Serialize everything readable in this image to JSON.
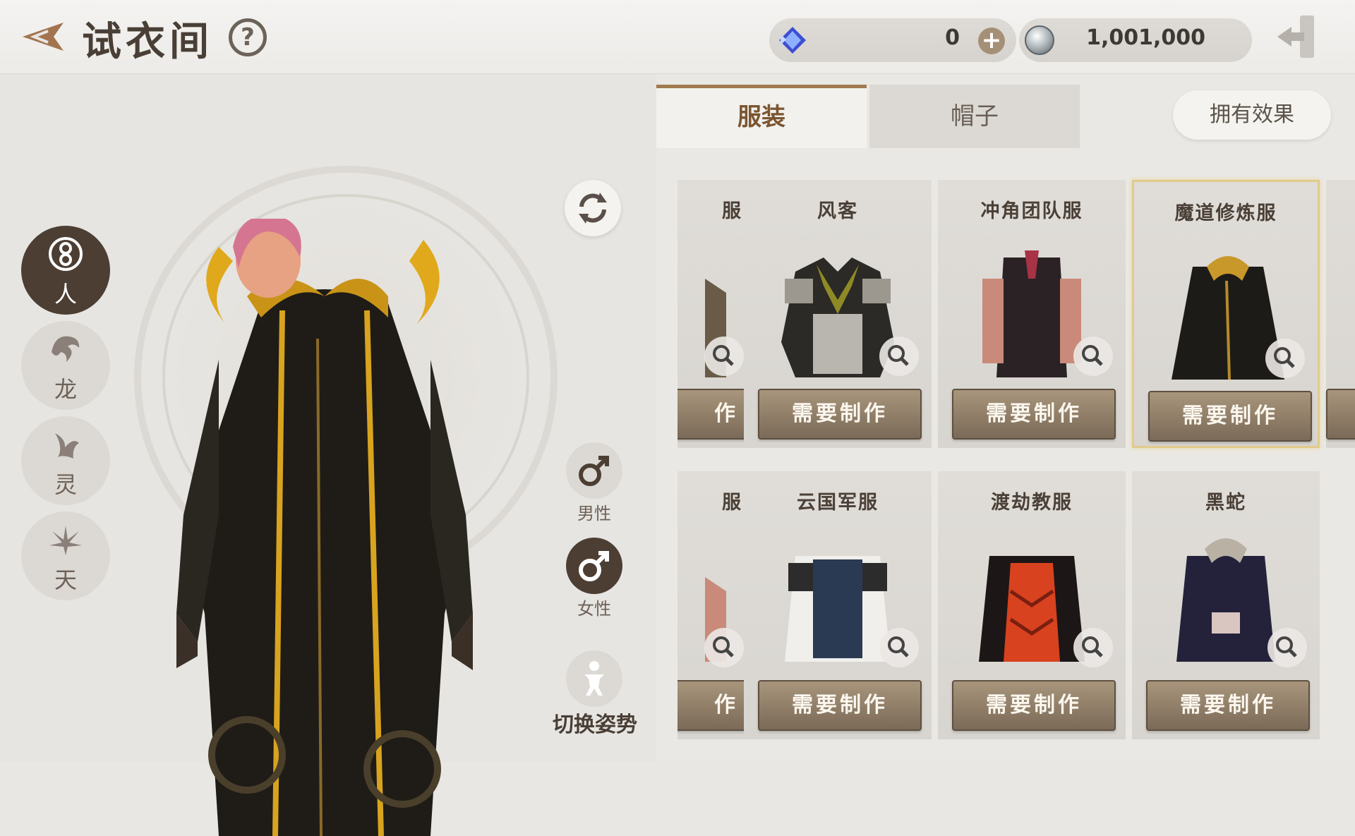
{
  "header": {
    "title": "试衣间",
    "help": "?"
  },
  "currency": {
    "gems": "0",
    "plus": "+",
    "coins": "1,001,000"
  },
  "races": [
    {
      "label": "人",
      "active": true
    },
    {
      "label": "龙",
      "active": false
    },
    {
      "label": "灵",
      "active": false
    },
    {
      "label": "天",
      "active": false
    }
  ],
  "gender": {
    "male": "男性",
    "female": "女性",
    "selected": "female"
  },
  "pose_label": "切换姿势",
  "tabs": {
    "clothes": "服装",
    "hats": "帽子",
    "active": "clothes"
  },
  "effects_label": "拥有效果",
  "outfits": [
    {
      "name": "服",
      "craft": "作",
      "partial": true
    },
    {
      "name": "风客",
      "craft": "需要制作"
    },
    {
      "name": "冲角团队服",
      "craft": "需要制作"
    },
    {
      "name": "魔道修炼服",
      "craft": "需要制作",
      "selected": true
    },
    {
      "name": "服",
      "craft": "作",
      "partial": true
    },
    {
      "name": "云国军服",
      "craft": "需要制作"
    },
    {
      "name": "渡劫教服",
      "craft": "需要制作"
    },
    {
      "name": "黑蛇",
      "craft": "需要制作"
    }
  ]
}
